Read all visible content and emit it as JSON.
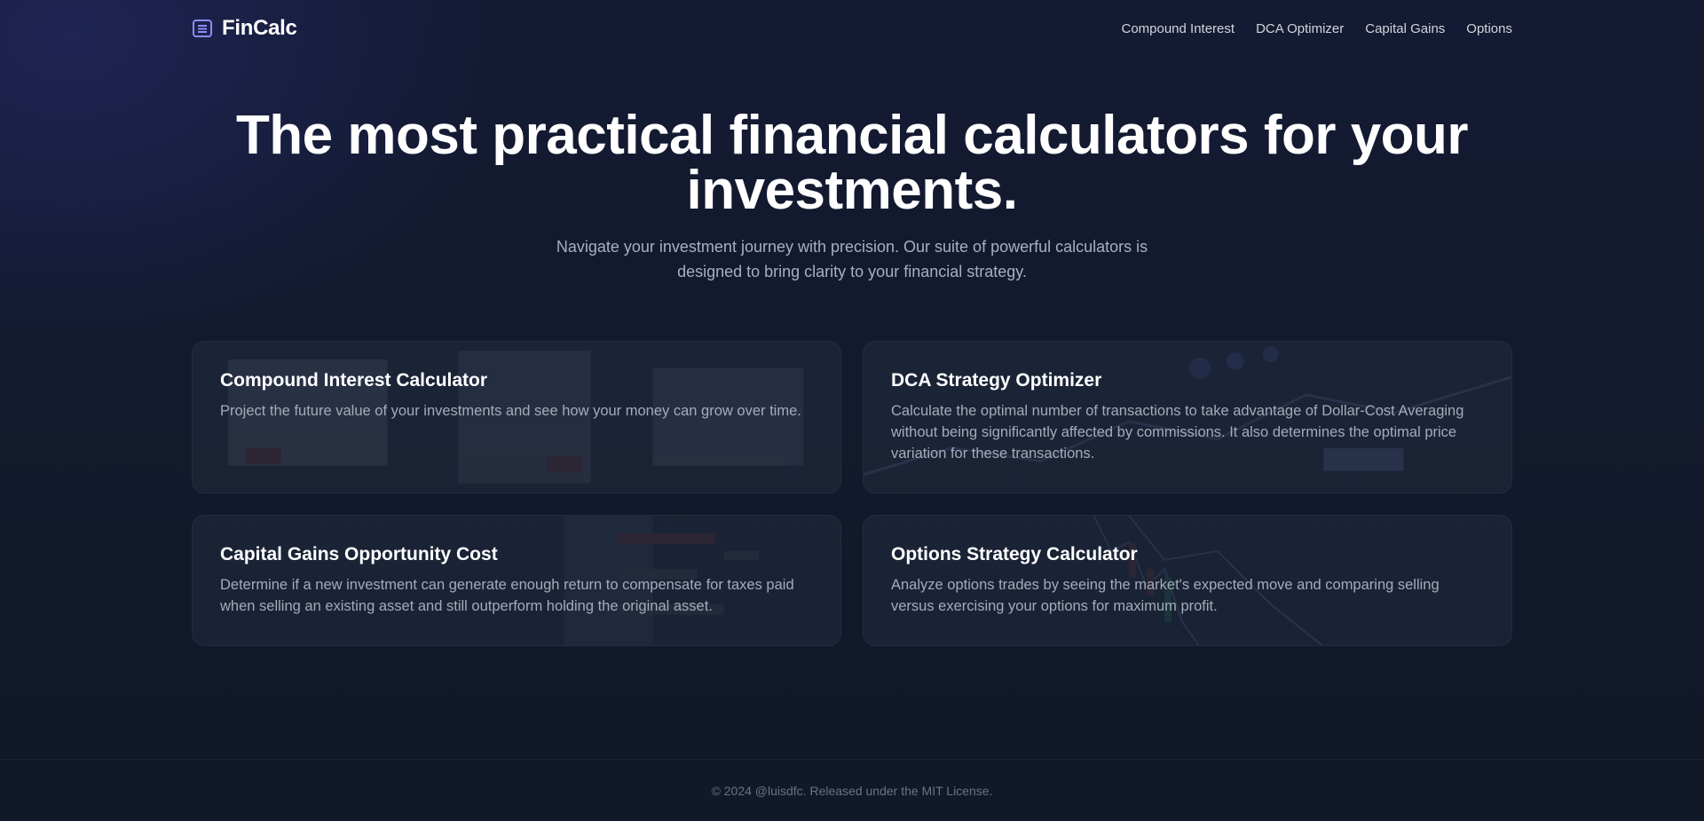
{
  "header": {
    "brand": "FinCalc",
    "brand_icon": "calculator-icon",
    "brand_color": "#8b8ff5",
    "nav": [
      {
        "label": "Compound Interest"
      },
      {
        "label": "DCA Optimizer"
      },
      {
        "label": "Capital Gains"
      },
      {
        "label": "Options"
      }
    ]
  },
  "hero": {
    "title": "The most practical financial calculators for your investments.",
    "subtitle": "Navigate your investment journey with precision. Our suite of powerful calculators is designed to bring clarity to your financial strategy."
  },
  "cards": [
    {
      "title": "Compound Interest Calculator",
      "description": "Project the future value of your investments and see how your money can grow over time."
    },
    {
      "title": "DCA Strategy Optimizer",
      "description": "Calculate the optimal number of transactions to take advantage of Dollar-Cost Averaging without being significantly affected by commissions. It also determines the optimal price variation for these transactions."
    },
    {
      "title": "Capital Gains Opportunity Cost",
      "description": "Determine if a new investment can generate enough return to compensate for taxes paid when selling an existing asset and still outperform holding the original asset."
    },
    {
      "title": "Options Strategy Calculator",
      "description": "Analyze options trades by seeing the market's expected move and comparing selling versus exercising your options for maximum profit."
    }
  ],
  "footer": {
    "text": "© 2024 @luisdfc. Released under the MIT License."
  },
  "colors": {
    "background": "#111827",
    "card": "#1e2638",
    "text_muted": "#a3acbb"
  }
}
